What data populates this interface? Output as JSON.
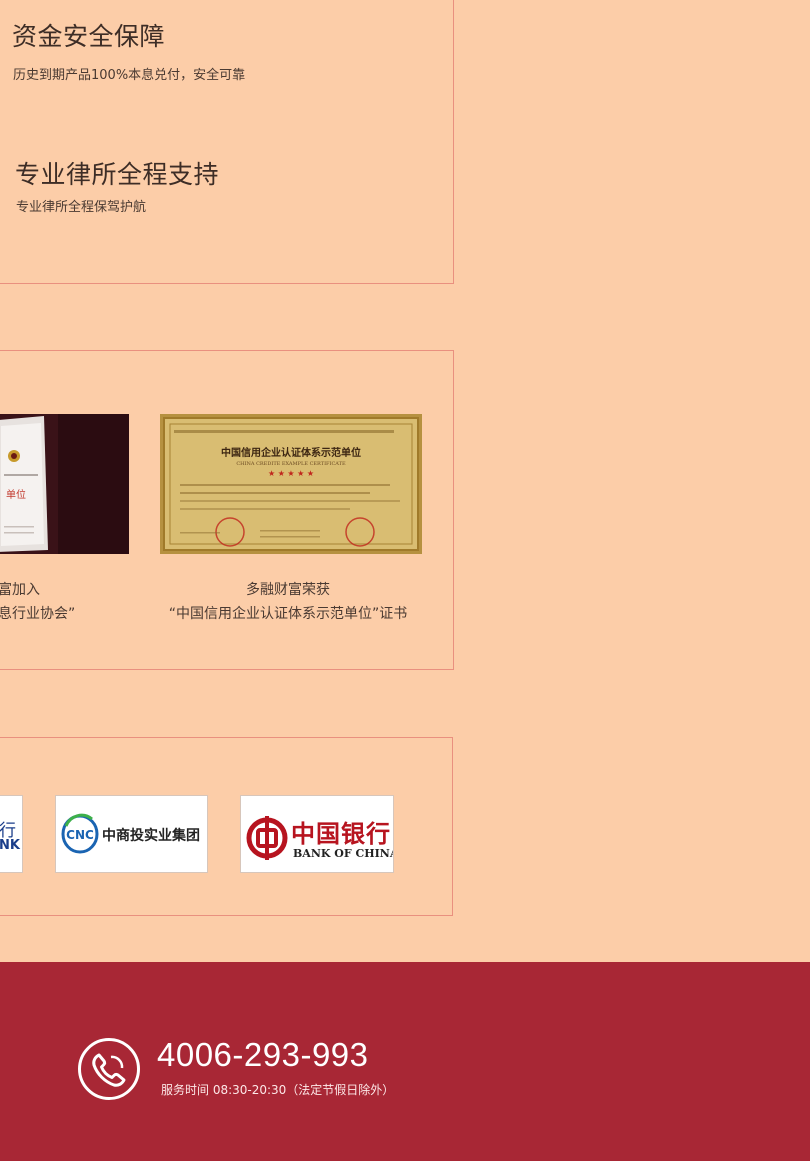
{
  "security_section": {
    "feature1_title": "资金安全保障",
    "feature1_desc": "历史到期产品100%本息兑付，安全可靠",
    "feature2_title": "专业律所全程支持",
    "feature2_desc": "专业律所全程保驾护航"
  },
  "certificates": [
    {
      "caption_line1": "富加入",
      "caption_line2": "息行业协会”",
      "plaque_text": "单位"
    },
    {
      "caption_line1": "多融财富荣获",
      "caption_line2": "“中国信用企业认证体系示范单位”证书",
      "cert_title": "中国信用企业认证体系示范单位",
      "cert_subtitle": "CHINA CREDITE EXAMPLE CERTIFICATE"
    }
  ],
  "partners": [
    {
      "name_cn": "行",
      "name_en": "NK"
    },
    {
      "name_cn": "中商投实业集团",
      "logo_mark": "CNC"
    },
    {
      "name_cn": "中国银行",
      "name_en": "BANK OF CHINA"
    }
  ],
  "footer": {
    "phone": "4006-293-993",
    "hours": "服务时间 08:30-20:30（法定节假日除外）"
  },
  "colors": {
    "page_bg": "#fccda8",
    "border": "#e9907f",
    "footer_bg": "#a82735",
    "boc_red": "#b7141f",
    "cnc_blue": "#1a64b2"
  }
}
